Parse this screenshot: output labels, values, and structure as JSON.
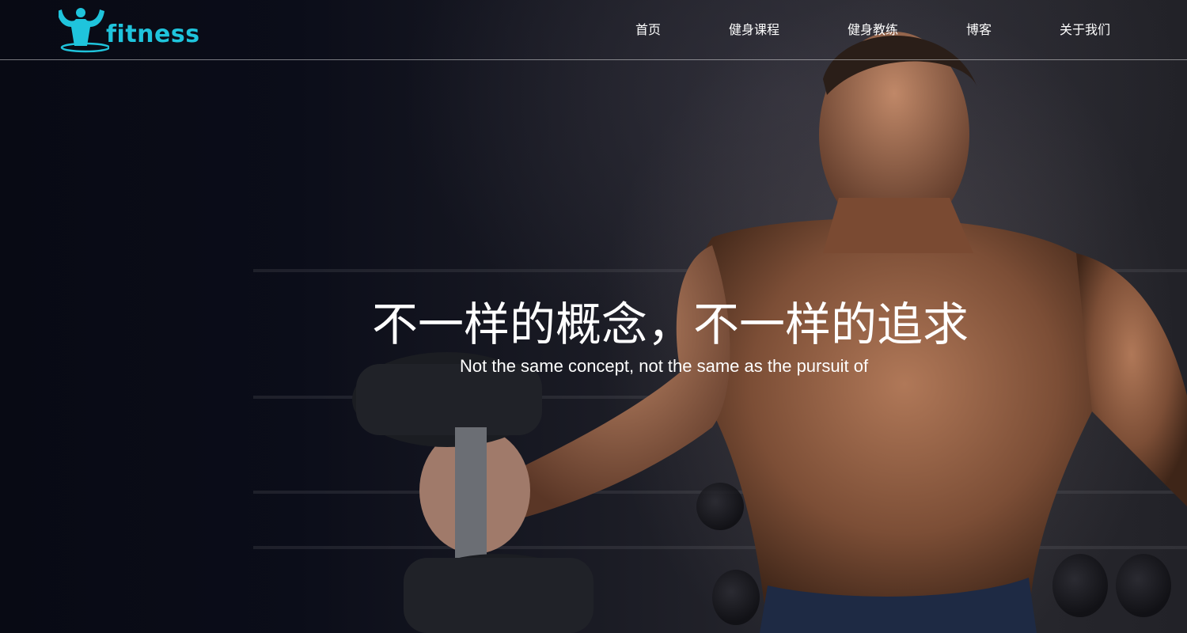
{
  "brand": {
    "logo_text": "fitness",
    "logo_color": "#1fc4dc"
  },
  "nav": {
    "items": [
      {
        "label": "首页"
      },
      {
        "label": "健身课程"
      },
      {
        "label": "健身教练"
      },
      {
        "label": "博客"
      },
      {
        "label": "关于我们"
      }
    ]
  },
  "hero": {
    "title": "不一样的概念，不一样的追求",
    "subtitle": "Not the same concept, not the same as the pursuit of",
    "image": "bodybuilder-with-dumbbell-photo"
  }
}
